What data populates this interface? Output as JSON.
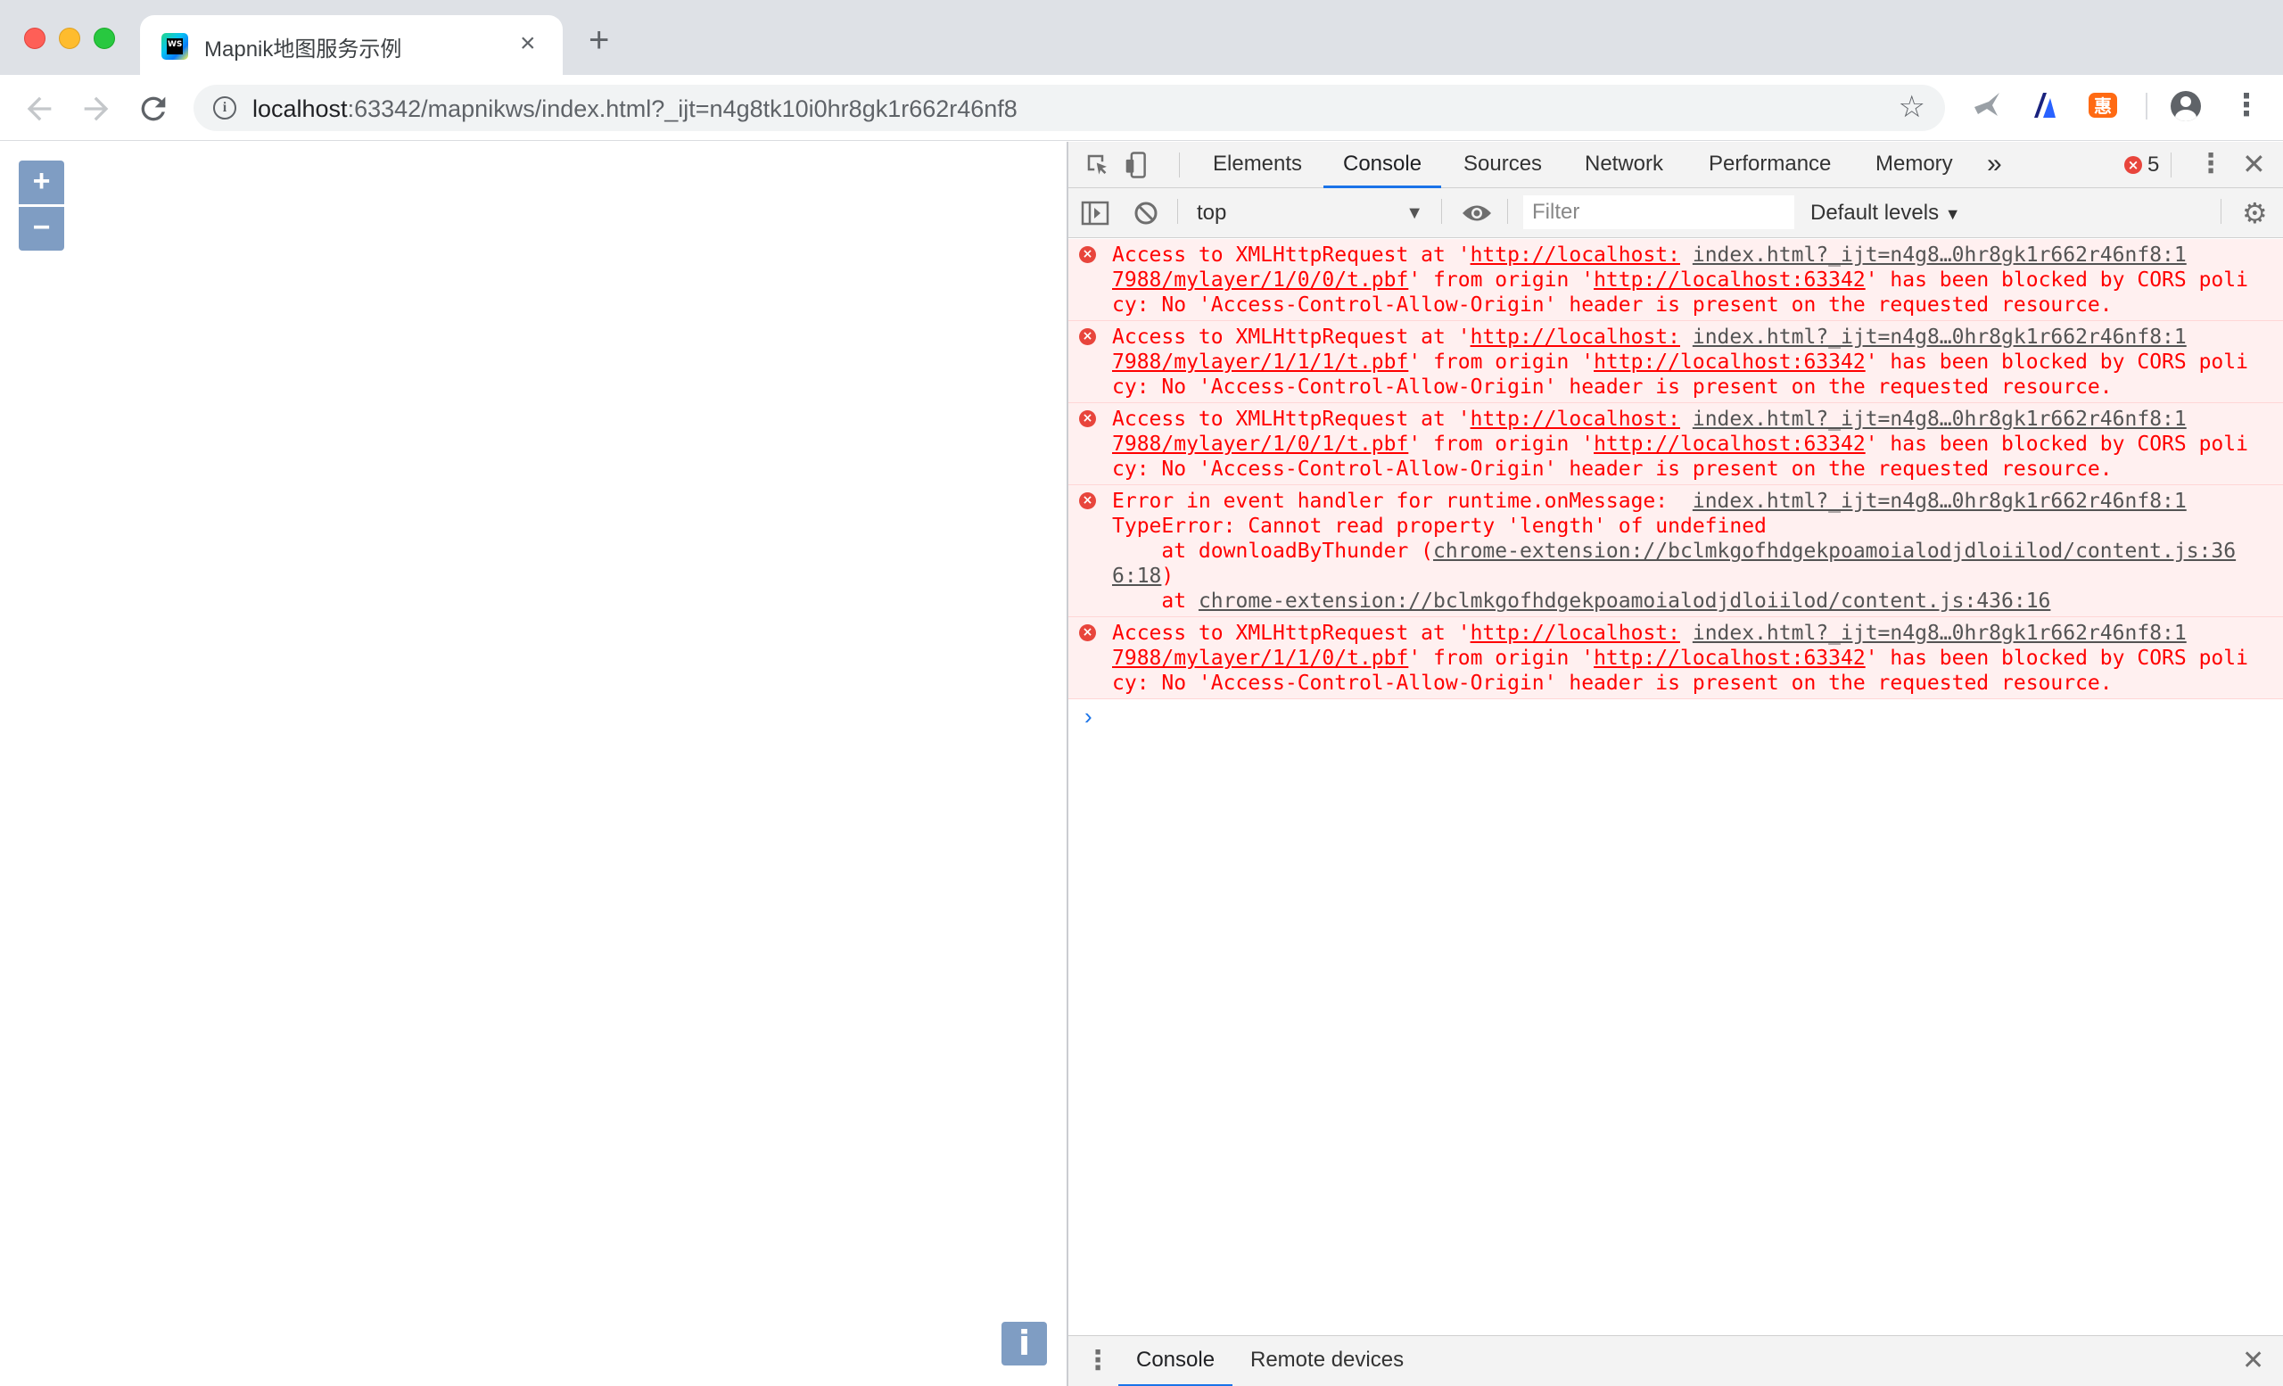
{
  "browser": {
    "tab": {
      "title": "Mapnik地图服务示例",
      "favicon_label": "WS"
    },
    "url": {
      "host": "localhost",
      "rest": ":63342/mapnikws/index.html?_ijt=n4g8tk10i0hr8gk1r662r46nf8"
    }
  },
  "map": {
    "zoom_in_label": "+",
    "zoom_out_label": "−",
    "attribution_label": "i"
  },
  "devtools": {
    "tabs": [
      "Elements",
      "Console",
      "Sources",
      "Network",
      "Performance",
      "Memory"
    ],
    "more_tabs_label": "»",
    "error_count": "5",
    "context": "top",
    "filter_placeholder": "Filter",
    "levels_label": "Default levels",
    "messages": [
      {
        "pre": "Access to XMLHttpRequest at '",
        "link1": "http://localhost:",
        "source": "index.html?_ijt=n4g8…0hr8gk1r662r46nf8:1",
        "link2": "7988/mylayer/1/0/0/t.pbf",
        "mid": "' from origin '",
        "origin": "http://localhost:63342",
        "post": "' has been blocked by CORS policy: No 'Access-Control-Allow-Origin' header is present on the requested resource."
      },
      {
        "pre": "Access to XMLHttpRequest at '",
        "link1": "http://localhost:",
        "source": "index.html?_ijt=n4g8…0hr8gk1r662r46nf8:1",
        "link2": "7988/mylayer/1/1/1/t.pbf",
        "mid": "' from origin '",
        "origin": "http://localhost:63342",
        "post": "' has been blocked by CORS policy: No 'Access-Control-Allow-Origin' header is present on the requested resource."
      },
      {
        "pre": "Access to XMLHttpRequest at '",
        "link1": "http://localhost:",
        "source": "index.html?_ijt=n4g8…0hr8gk1r662r46nf8:1",
        "link2": "7988/mylayer/1/0/1/t.pbf",
        "mid": "' from origin '",
        "origin": "http://localhost:63342",
        "post": "' has been blocked by CORS policy: No 'Access-Control-Allow-Origin' header is present on the requested resource."
      }
    ],
    "error_message": {
      "line1": "Error in event handler for runtime.onMessage: ",
      "source": "index.html?_ijt=n4g8…0hr8gk1r662r46nf8:1",
      "line2": "TypeError: Cannot read property 'length' of undefined",
      "at1_pre": "    at downloadByThunder (",
      "at1_link": "chrome-extension://bclmkgofhdgekpoamoialodjdloiilod/content.js:366:18",
      "at1_post": ")",
      "at2_pre": "    at ",
      "at2_link": "chrome-extension://bclmkgofhdgekpoamoialodjdloiilod/content.js:436:16"
    },
    "last_message": {
      "pre": "Access to XMLHttpRequest at '",
      "link1": "http://localhost:",
      "source": "index.html?_ijt=n4g8…0hr8gk1r662r46nf8:1",
      "link2": "7988/mylayer/1/1/0/t.pbf",
      "mid": "' from origin '",
      "origin": "http://localhost:63342",
      "post": "' has been blocked by CORS policy: No 'Access-Control-Allow-Origin' header is present on the requested resource."
    },
    "prompt_symbol": "›",
    "drawer_tabs": [
      "Console",
      "Remote devices"
    ]
  },
  "colors": {
    "error_text": "#ff0000",
    "error_bg": "#fff0f0",
    "active_tab_underline": "#1a73e8",
    "map_button": "#7f9dc3"
  }
}
